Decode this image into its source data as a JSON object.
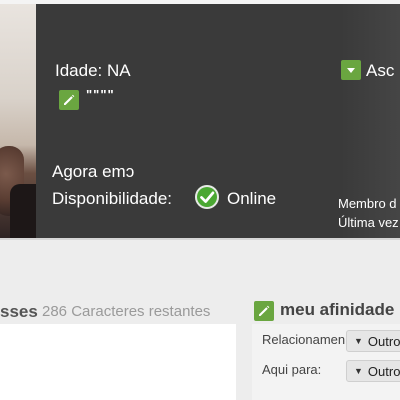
{
  "profile": {
    "age": "Idade: NA",
    "about_quote": "\"\"\"\"",
    "now_in": "Agora emɔ",
    "availability_label": "Disponibilidade:",
    "availability_value": "Online",
    "asc_label": "Asc",
    "membro_label": "Membro d",
    "ultima_label": "Última vez"
  },
  "about_section": {
    "title_fragment": "sses",
    "remaining_text": "286 Caracteres restantes"
  },
  "affinity": {
    "title": "meu afinidade",
    "relationship_label": "Relacionamen",
    "relationship_value": "Outro",
    "here_for_label": "Aqui para:",
    "here_for_value": "Outro"
  },
  "icons": {
    "edit": "pencil-icon",
    "dropdown": "chevron-down-icon",
    "online": "check-icon"
  },
  "colors": {
    "accent_green": "#6aa640",
    "online_green": "#4aa832",
    "panel_bg": "#3a3a3a"
  }
}
